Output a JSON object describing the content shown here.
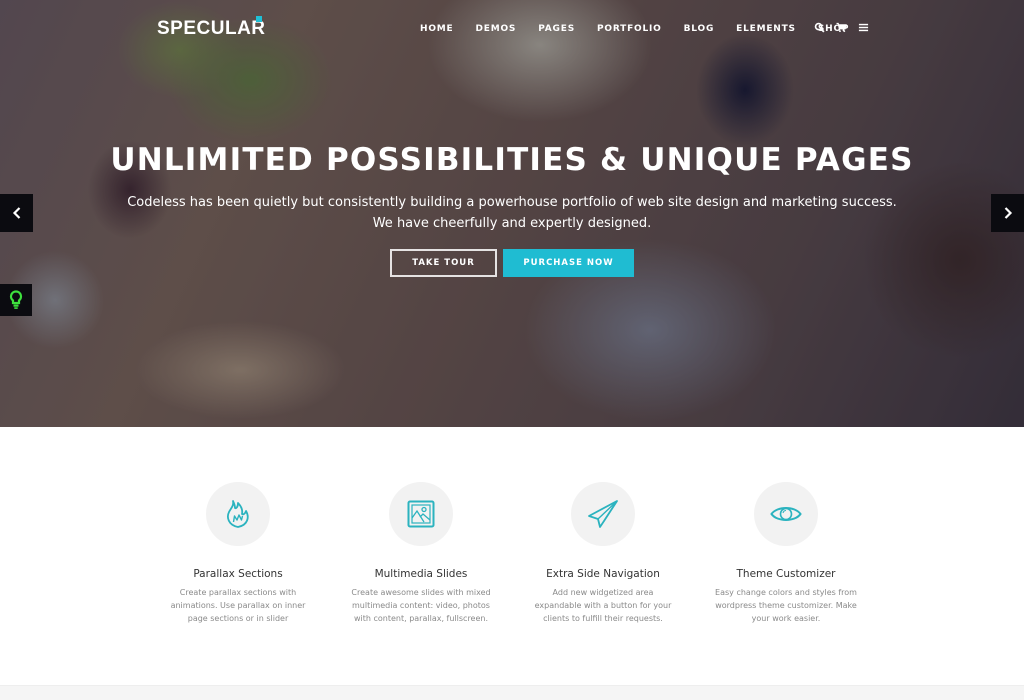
{
  "header": {
    "logo": "SPECULAR",
    "nav": [
      "HOME",
      "DEMOS",
      "PAGES",
      "PORTFOLIO",
      "BLOG",
      "ELEMENTS",
      "SHOP"
    ],
    "icons": [
      "search-icon",
      "cart-icon",
      "menu-icon"
    ]
  },
  "hero": {
    "title": "UNLIMITED POSSIBILITIES & UNIQUE PAGES",
    "subtitle_line1": "Codeless has been quietly but consistently building a powerhouse portfolio of web site design and marketing success.",
    "subtitle_line2": "We have cheerfully and expertly designed.",
    "buttons": {
      "tour": "TAKE TOUR",
      "purchase": "PURCHASE NOW"
    }
  },
  "features": [
    {
      "icon": "flame-icon",
      "title": "Parallax Sections",
      "desc": [
        "Create parallax sections with",
        "animations. Use parallax on inner",
        "page sections or in slider"
      ]
    },
    {
      "icon": "image-icon",
      "title": "Multimedia Slides",
      "desc": [
        "Create awesome slides with mixed",
        "multimedia content: video, photos",
        "with content, parallax, fullscreen."
      ]
    },
    {
      "icon": "paper-plane-icon",
      "title": "Extra Side Navigation",
      "desc": [
        "Add new widgetized area",
        "expandable with a button for your",
        "clients to fulfill their requests."
      ]
    },
    {
      "icon": "eye-icon",
      "title": "Theme Customizer",
      "desc": [
        "Easy change colors and styles from",
        "wordpress theme customizer. Make",
        "your work easier."
      ]
    }
  ],
  "colors": {
    "accent": "#1fbcd2",
    "icon_stroke": "#2bb3bf",
    "side_tool_icon": "#3ee03e",
    "text_dark": "#333333",
    "text_muted": "#8a8a8a"
  }
}
